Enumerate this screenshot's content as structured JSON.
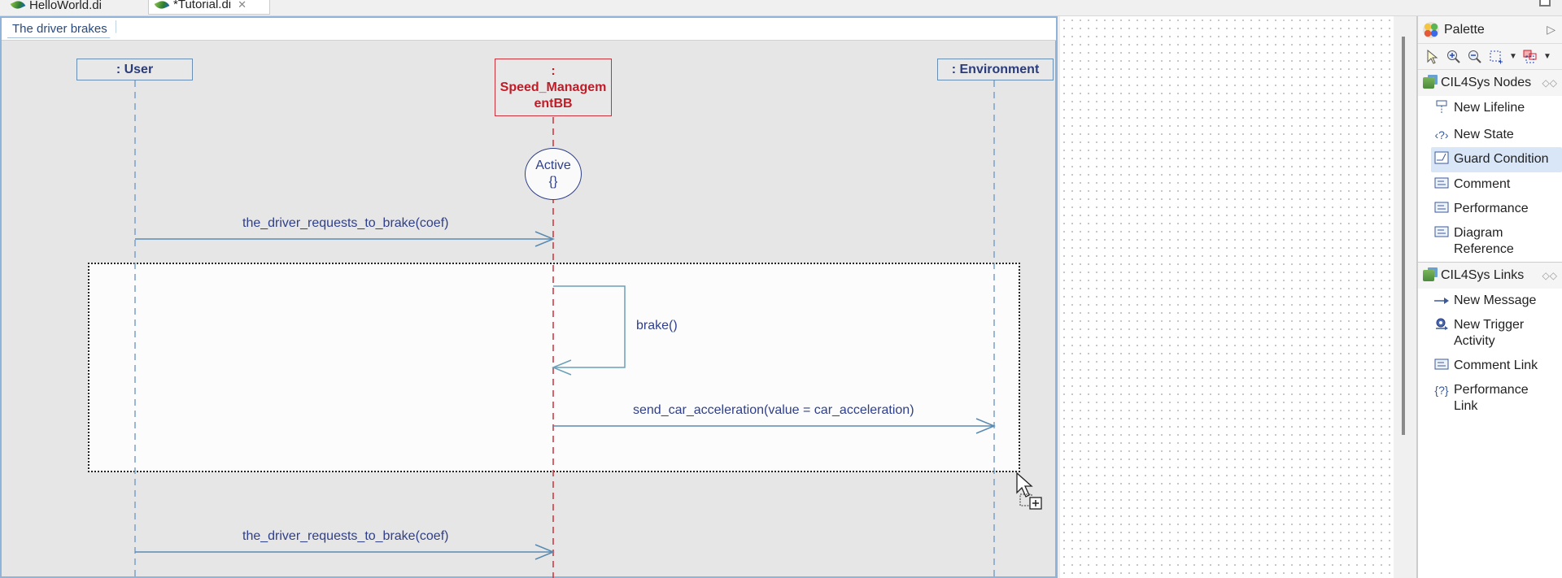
{
  "tabs": [
    {
      "label": "HelloWorld.di",
      "active": false
    },
    {
      "label": "*Tutorial.di",
      "active": true
    }
  ],
  "diagram": {
    "title": "The driver brakes",
    "lifelines": [
      {
        "name": ": User",
        "color": "#2a3c7a"
      },
      {
        "name": ":\nSpeed_ManagementBB",
        "line1": ":",
        "line2": "Speed_Managem",
        "line3": "entBB",
        "color": "#c01c28"
      },
      {
        "name": ": Environment",
        "color": "#2a3c7a"
      }
    ],
    "state": {
      "line1": "Active",
      "line2": "{}"
    },
    "messages": [
      {
        "label": "the_driver_requests_to_brake(coef)",
        "from": ": User",
        "to": ":Speed_ManagementBB"
      },
      {
        "label": "brake()",
        "from": ":Speed_ManagementBB",
        "to": ":Speed_ManagementBB"
      },
      {
        "label": "send_car_acceleration(value = car_acceleration)",
        "from": ":Speed_ManagementBB",
        "to": ": Environment"
      },
      {
        "label": "the_driver_requests_to_brake(coef)",
        "from": ": User",
        "to": ":Speed_ManagementBB"
      }
    ]
  },
  "palette": {
    "title": "Palette",
    "tools": [
      "select-icon",
      "zoom-in-icon",
      "zoom-out-icon",
      "marquee-icon",
      "connection-marquee-icon"
    ],
    "drawers": [
      {
        "label": "CIL4Sys Nodes",
        "items": [
          {
            "label": "New Lifeline",
            "icon": "lifeline-icon"
          },
          {
            "label": "New State",
            "icon": "state-icon"
          },
          {
            "label": "Guard Condition",
            "icon": "guard-icon",
            "highlighted": true
          },
          {
            "label": "Comment",
            "icon": "comment-icon"
          },
          {
            "label": "Performance",
            "icon": "comment-icon"
          },
          {
            "label": "Diagram Reference",
            "icon": "comment-icon"
          }
        ]
      },
      {
        "label": "CIL4Sys Links",
        "items": [
          {
            "label": "New Message",
            "icon": "arrow-icon"
          },
          {
            "label": "New Trigger Activity",
            "icon": "trigger-icon"
          },
          {
            "label": "Comment Link",
            "icon": "comment-icon"
          },
          {
            "label": "Performance Link",
            "icon": "performance-link-icon"
          }
        ]
      }
    ]
  },
  "colors": {
    "lifeline_blue": "#6a8fb5",
    "lifeline_red": "#c8323c",
    "message_line": "#5a8ab0",
    "label_text": "#2f3f8a",
    "highlight": "#d8e6f7"
  }
}
